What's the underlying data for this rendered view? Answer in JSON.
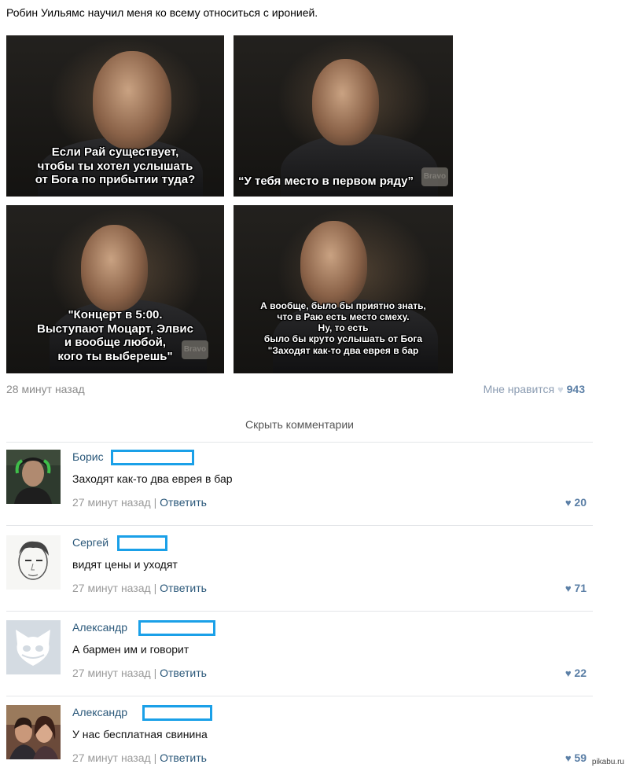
{
  "post": {
    "text": "Робин Уильямс научил меня ко всему относиться с иронией.",
    "panels": [
      {
        "caption_lines": [
          "Если Рай существует,",
          "чтобы ты хотел услышать",
          "от Бога по прибытии туда?"
        ]
      },
      {
        "caption_lines": [
          "“У тебя место в первом ряду”"
        ]
      },
      {
        "caption_lines": [
          "\"Концерт в 5:00.",
          "Выступают Моцарт, Элвис",
          "и вообще любой,",
          "кого ты выберешь\""
        ]
      },
      {
        "caption_lines": [
          "А вообще, было бы приятно знать,",
          "что в Раю есть место смеху.",
          "Ну, то есть",
          "было бы круто услышать от Бога",
          "\"Заходят как-то два еврея в бар"
        ]
      }
    ],
    "watermark": "Bravo",
    "time": "28 минут назад",
    "like_label": "Мне нравится",
    "like_count": "943"
  },
  "hide_comments": "Скрыть комментарии",
  "comments": [
    {
      "name": "Борис",
      "text": "Заходят как-то два еврея в бар",
      "time": "27 минут назад",
      "reply": "Ответить",
      "likes": "20"
    },
    {
      "name": "Сергей",
      "text": "видят цены и уходят",
      "time": "27 минут назад",
      "reply": "Ответить",
      "likes": "71"
    },
    {
      "name": "Александр",
      "text": "А бармен им и говорит",
      "time": "27 минут назад",
      "reply": "Ответить",
      "likes": "22"
    },
    {
      "name": "Александр",
      "text": "У нас бесплатная свинина",
      "time": "27 минут назад",
      "reply": "Ответить",
      "likes": "59"
    }
  ],
  "footer_watermark": "pikabu.ru",
  "icons": {
    "like": "heart-icon"
  },
  "colors": {
    "link": "#2b587a",
    "redaction": "#1aa0e8",
    "like": "#5b7fa6"
  }
}
